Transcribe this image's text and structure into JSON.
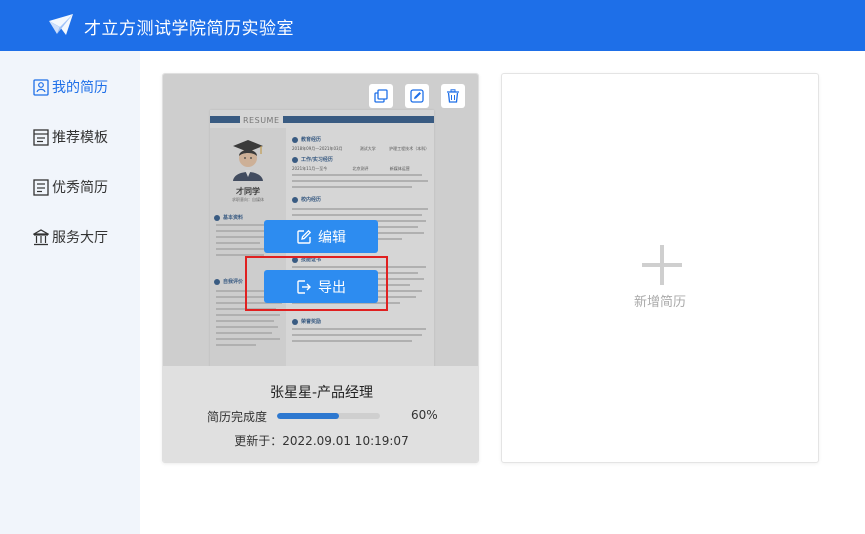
{
  "header": {
    "title": "才立方测试学院简历实验室",
    "bg_color": "#1e6fe8",
    "logo_icon": "paper-plane-logo"
  },
  "sidebar": {
    "items": [
      {
        "label": "我的简历",
        "icon": "resume-icon",
        "active": true
      },
      {
        "label": "推荐模板",
        "icon": "template-icon",
        "active": false
      },
      {
        "label": "优秀简历",
        "icon": "document-icon",
        "active": false
      },
      {
        "label": "服务大厅",
        "icon": "bank-icon",
        "active": false
      }
    ],
    "active_color": "#1e6fe8"
  },
  "resume_card": {
    "title": "张星星-产品经理",
    "progress_label": "简历完成度",
    "progress_percent": 60,
    "progress_text": "60%",
    "updated": "更新于：2022.09.01 10:19:07",
    "edit_label": "编辑",
    "export_label": "导出",
    "tools": [
      "copy-icon",
      "edit-icon",
      "trash-icon"
    ],
    "preview": {
      "header_word": "RESUME",
      "name": "才同学",
      "role": "求职意向：自媒体",
      "sections": {
        "basic": "基本资料",
        "self": "自我评价",
        "edu": "教育经历",
        "work": "工作/实习经历",
        "campus": "校内经历",
        "skills": "技能证书",
        "honors": "荣誉奖励"
      },
      "edu_line": "2018年09月—2021年03月　　　　 测试大学　　　 护理工程技术（本科）",
      "work_line": "2021年11月—至今　　　　　　 北京测评　　　　　 新媒体运营"
    }
  },
  "new_card": {
    "label": "新增简历",
    "icon": "plus-icon"
  },
  "highlight_color": "#e02020"
}
